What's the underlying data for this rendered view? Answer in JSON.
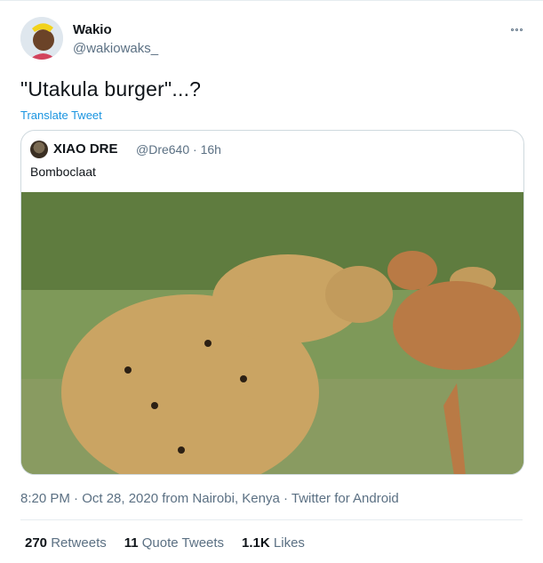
{
  "author": {
    "name": "Wakio",
    "handle": "@wakiowaks_"
  },
  "tweet_text": "\"Utakula burger\"...?",
  "translate_label": "Translate Tweet",
  "quoted": {
    "name": "XIAO DRE",
    "meta": "@Dre640 · 16h",
    "text": "Bomboclaat",
    "photo_alt": "Leopard nuzzling a young impala"
  },
  "timestamp": "8:20 PM · Oct 28, 2020 from Nairobi, Kenya · Twitter for Android",
  "stats": [
    {
      "value": "270",
      "label": "Retweets"
    },
    {
      "value": "11",
      "label": "Quote Tweets"
    },
    {
      "value": "1.1K",
      "label": "Likes"
    }
  ],
  "colors": {
    "link": "#1b95e0",
    "muted": "#5b7083",
    "border": "#cfd9de"
  },
  "icons": [
    "more-options-icon"
  ]
}
